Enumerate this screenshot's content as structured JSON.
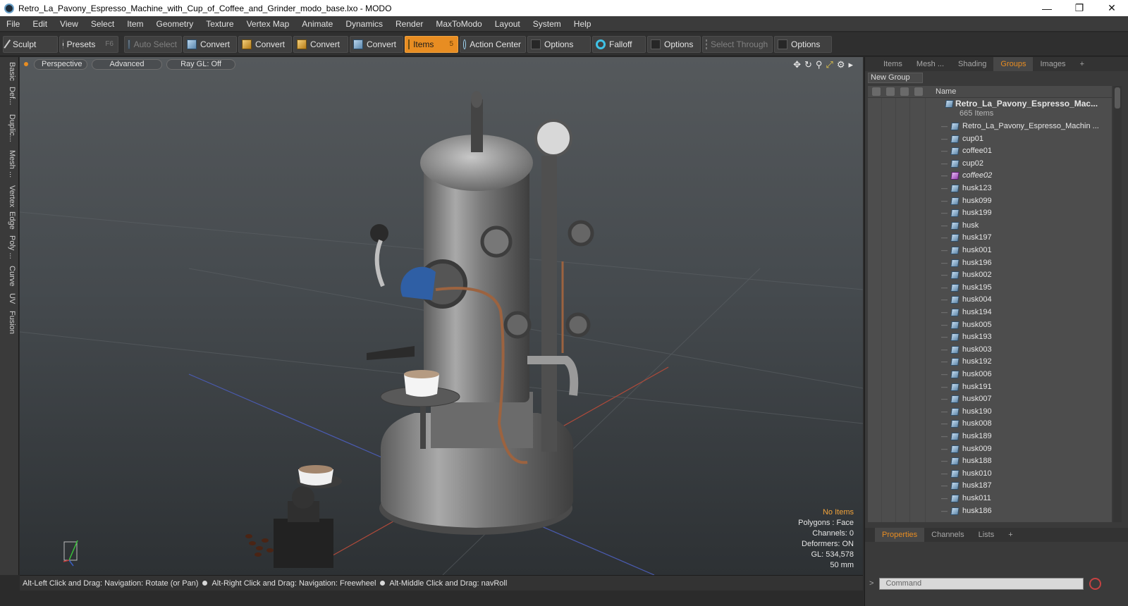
{
  "window": {
    "title": "Retro_La_Pavony_Espresso_Machine_with_Cup_of_Coffee_and_Grinder_modo_base.lxo - MODO",
    "minimize": "—",
    "maximize": "❐",
    "close": "✕"
  },
  "menu": [
    "File",
    "Edit",
    "View",
    "Select",
    "Item",
    "Geometry",
    "Texture",
    "Vertex Map",
    "Animate",
    "Dynamics",
    "Render",
    "MaxToModo",
    "Layout",
    "System",
    "Help"
  ],
  "toolbar": {
    "sculpt": "Sculpt",
    "presets": "Presets",
    "presets_key": "F6",
    "auto_select": "Auto Select",
    "convert1": "Convert",
    "convert2": "Convert",
    "convert3": "Convert",
    "convert4": "Convert",
    "items": "Items",
    "items_key": "5",
    "action_center": "Action Center",
    "options1": "Options",
    "falloff": "Falloff",
    "options2": "Options",
    "select_through": "Select Through",
    "options3": "Options"
  },
  "left_tabs": [
    "Basic",
    "Def...",
    "Duplic...",
    "Mesh ...",
    "Vertex",
    "Edge",
    "Poly ...",
    "Curve",
    "UV",
    "Fusion"
  ],
  "viewport": {
    "view": "Perspective",
    "shading": "Advanced",
    "raygl": "Ray GL: Off",
    "info": {
      "items": "No Items",
      "polygons": "Polygons : Face",
      "channels": "Channels: 0",
      "deformers": "Deformers: ON",
      "gl": "GL: 534,578",
      "scale": "50 mm"
    }
  },
  "status": {
    "hint1": "Alt-Left Click and Drag: Navigation: Rotate (or Pan)",
    "hint2": "Alt-Right Click and Drag: Navigation: Freewheel",
    "hint3": "Alt-Middle Click and Drag: navRoll"
  },
  "panel": {
    "tabs": [
      "Items",
      "Mesh ...",
      "Shading",
      "Groups",
      "Images"
    ],
    "active_tab": "Groups",
    "new_group": "New Group",
    "col_name": "Name",
    "root": {
      "name": "Retro_La_Pavony_Espresso_Mac...",
      "count": "665 Items"
    },
    "items": [
      {
        "name": "Retro_La_Pavony_Espresso_Machin ...",
        "icon": "locator-icon"
      },
      {
        "name": "cup01",
        "icon": "mesh-icon"
      },
      {
        "name": "coffee01",
        "icon": "mesh-icon"
      },
      {
        "name": "cup02",
        "icon": "mesh-icon"
      },
      {
        "name": "coffee02",
        "icon": "mesh-instance-icon"
      },
      {
        "name": "husk123",
        "icon": "mesh-icon"
      },
      {
        "name": "husk099",
        "icon": "mesh-icon"
      },
      {
        "name": "husk199",
        "icon": "mesh-icon"
      },
      {
        "name": "husk",
        "icon": "mesh-icon"
      },
      {
        "name": "husk197",
        "icon": "mesh-icon"
      },
      {
        "name": "husk001",
        "icon": "mesh-icon"
      },
      {
        "name": "husk196",
        "icon": "mesh-icon"
      },
      {
        "name": "husk002",
        "icon": "mesh-icon"
      },
      {
        "name": "husk195",
        "icon": "mesh-icon"
      },
      {
        "name": "husk004",
        "icon": "mesh-icon"
      },
      {
        "name": "husk194",
        "icon": "mesh-icon"
      },
      {
        "name": "husk005",
        "icon": "mesh-icon"
      },
      {
        "name": "husk193",
        "icon": "mesh-icon"
      },
      {
        "name": "husk003",
        "icon": "mesh-icon"
      },
      {
        "name": "husk192",
        "icon": "mesh-icon"
      },
      {
        "name": "husk006",
        "icon": "mesh-icon"
      },
      {
        "name": "husk191",
        "icon": "mesh-icon"
      },
      {
        "name": "husk007",
        "icon": "mesh-icon"
      },
      {
        "name": "husk190",
        "icon": "mesh-icon"
      },
      {
        "name": "husk008",
        "icon": "mesh-icon"
      },
      {
        "name": "husk189",
        "icon": "mesh-icon"
      },
      {
        "name": "husk009",
        "icon": "mesh-icon"
      },
      {
        "name": "husk188",
        "icon": "mesh-icon"
      },
      {
        "name": "husk010",
        "icon": "mesh-icon"
      },
      {
        "name": "husk187",
        "icon": "mesh-icon"
      },
      {
        "name": "husk011",
        "icon": "mesh-icon"
      },
      {
        "name": "husk186",
        "icon": "mesh-icon"
      }
    ],
    "bottom_tabs": [
      "Properties",
      "Channels",
      "Lists"
    ],
    "command_placeholder": "Command",
    "prompt": ">"
  },
  "colors": {
    "accent": "#e88d22",
    "viewport_top": "#55595c",
    "viewport_bottom": "#2d3134"
  }
}
